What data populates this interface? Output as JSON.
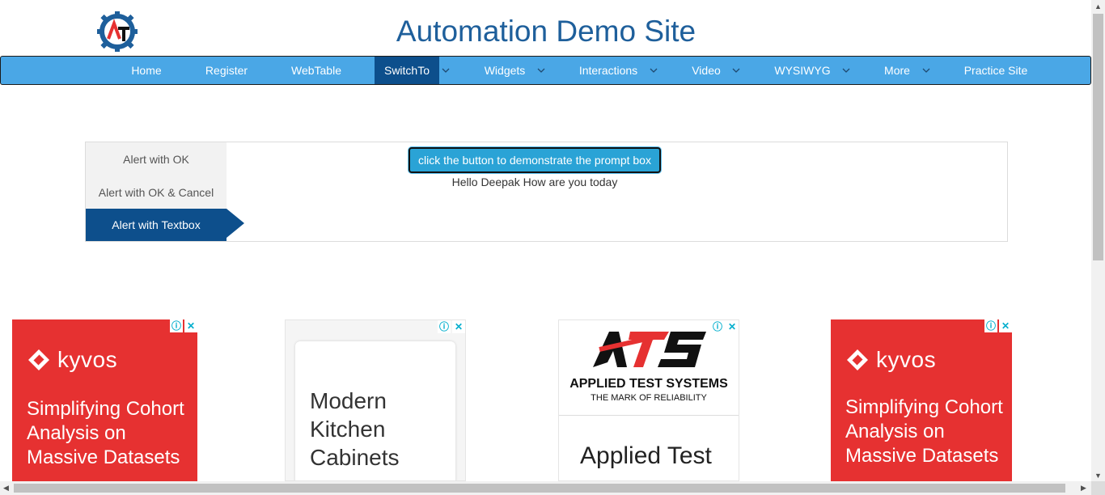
{
  "header": {
    "title": "Automation Demo Site",
    "logo_letters": "AT"
  },
  "nav": {
    "items": [
      {
        "label": "Home"
      },
      {
        "label": "Register"
      },
      {
        "label": "WebTable"
      },
      {
        "label": "SwitchTo"
      },
      {
        "label": "Widgets"
      },
      {
        "label": "Interactions"
      },
      {
        "label": "Video"
      },
      {
        "label": "WYSIWYG"
      },
      {
        "label": "More"
      },
      {
        "label": "Practice Site"
      }
    ],
    "active": "SwitchTo",
    "colors": {
      "bar": "#4aa7e6",
      "active": "#0d4f8c"
    }
  },
  "alerts": {
    "tabs": [
      {
        "label": "Alert with OK"
      },
      {
        "label": "Alert with OK & Cancel"
      },
      {
        "label": "Alert with Textbox"
      }
    ],
    "active_tab": "Alert with Textbox",
    "button_label": "click the button to demonstrate the prompt box",
    "result_text": "Hello Deepak How are you today"
  },
  "ads": [
    {
      "brand": "kyvos",
      "text": "Simplifying Cohort Analysis on Massive Datasets"
    },
    {
      "text": "Modern Kitchen Cabinets"
    },
    {
      "brand": "ATS",
      "name": "APPLIED TEST SYSTEMS",
      "tagline": "THE MARK OF RELIABILITY",
      "text": "Applied Test"
    },
    {
      "brand": "kyvos",
      "text": "Simplifying Cohort Analysis on Massive Datasets"
    }
  ],
  "ad_controls": {
    "info": "ⓘ",
    "close": "✕"
  }
}
